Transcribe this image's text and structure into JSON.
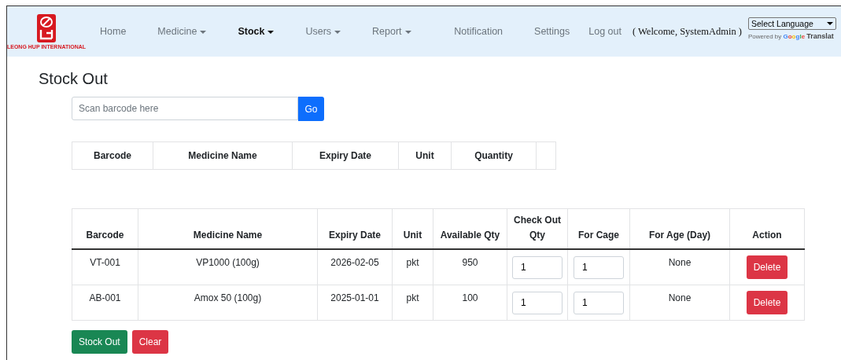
{
  "brand": {
    "name": "LEONG HUP INTERNATIONAL"
  },
  "nav": [
    {
      "label": "Home",
      "dropdown": false,
      "selected": false
    },
    {
      "label": "Medicine",
      "dropdown": true,
      "selected": false
    },
    {
      "label": "Stock",
      "dropdown": true,
      "selected": true
    },
    {
      "label": "Users",
      "dropdown": true,
      "selected": false
    },
    {
      "label": "Report",
      "dropdown": true,
      "selected": false
    }
  ],
  "nav_right": [
    {
      "label": "Notification"
    },
    {
      "label": "Settings"
    },
    {
      "label": "Log out"
    }
  ],
  "welcome": "( Welcome, SystemAdmin )",
  "language": {
    "value": "Select Language",
    "powered_by": "Powered by",
    "google": "Google",
    "translate": "Translat"
  },
  "page_title": "Stock Out",
  "scan": {
    "placeholder": "Scan barcode here",
    "button": "Go"
  },
  "scan_table": {
    "columns": [
      "Barcode",
      "Medicine Name",
      "Expiry Date",
      "Unit",
      "Quantity",
      ""
    ]
  },
  "table": {
    "columns": [
      "Barcode",
      "Medicine Name",
      "Expiry Date",
      "Unit",
      "Available Qty",
      "Check Out Qty",
      "For Cage",
      "For Age (Day)",
      "Action"
    ],
    "rows": [
      {
        "barcode": "VT-001",
        "name": "VP1000 (100g)",
        "expiry": "2026-02-05",
        "unit": "pkt",
        "available": "950",
        "checkout_qty": "1",
        "for_cage": "1",
        "for_age": "None",
        "action": "Delete"
      },
      {
        "barcode": "AB-001",
        "name": "Amox 50 (100g)",
        "expiry": "2025-01-01",
        "unit": "pkt",
        "available": "100",
        "checkout_qty": "1",
        "for_cage": "1",
        "for_age": "None",
        "action": "Delete"
      }
    ]
  },
  "buttons": [
    {
      "label": "Stock Out",
      "kind": "primary"
    },
    {
      "label": "Clear",
      "kind": "danger"
    }
  ]
}
